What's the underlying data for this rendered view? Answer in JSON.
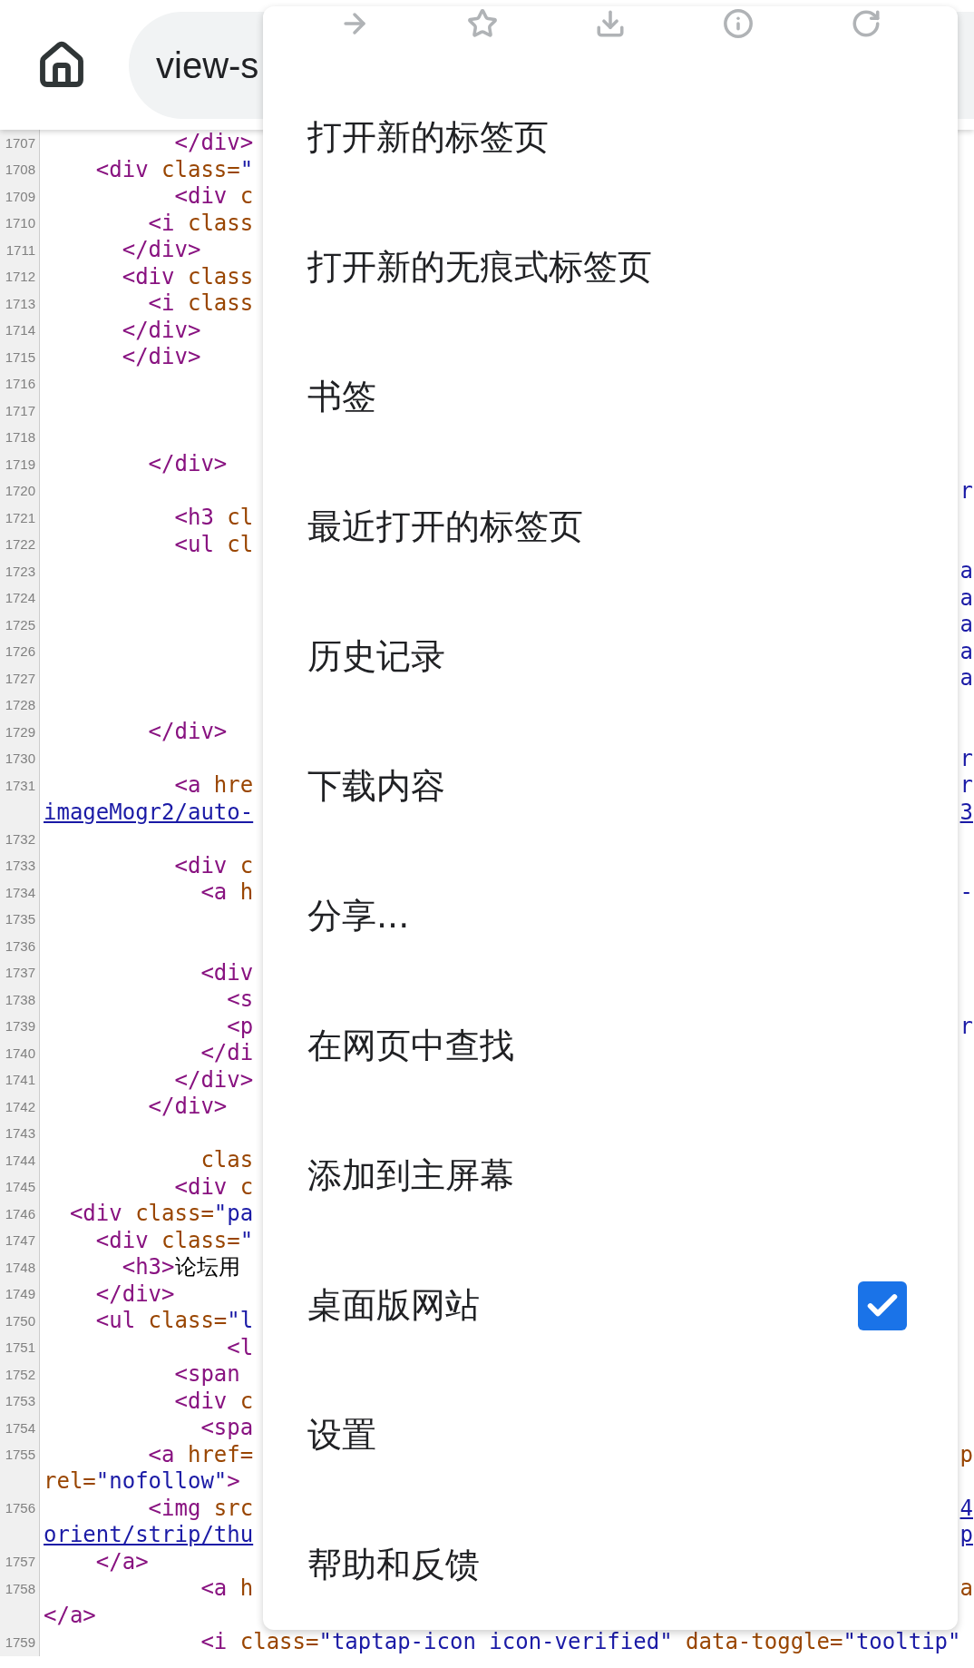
{
  "toolbar": {
    "url": "view-s"
  },
  "source": {
    "rows": [
      {
        "number": "1707",
        "segments": [
          {
            "kind": "tag",
            "text": "          </div>"
          }
        ]
      },
      {
        "number": "1708",
        "segments": [
          {
            "kind": "tag",
            "text": "    <div"
          },
          {
            "kind": "attr",
            "text": " class="
          },
          {
            "kind": "value",
            "text": "\""
          }
        ]
      },
      {
        "number": "1709",
        "segments": [
          {
            "kind": "tag",
            "text": "          <div"
          },
          {
            "kind": "attr",
            "text": " c"
          }
        ]
      },
      {
        "number": "1710",
        "segments": [
          {
            "kind": "tag",
            "text": "        <i"
          },
          {
            "kind": "attr",
            "text": " class"
          }
        ]
      },
      {
        "number": "1711",
        "segments": [
          {
            "kind": "tag",
            "text": "      </div>"
          }
        ]
      },
      {
        "number": "1712",
        "segments": [
          {
            "kind": "tag",
            "text": "      <div"
          },
          {
            "kind": "attr",
            "text": " class"
          }
        ]
      },
      {
        "number": "1713",
        "segments": [
          {
            "kind": "tag",
            "text": "        <i"
          },
          {
            "kind": "attr",
            "text": " class"
          }
        ]
      },
      {
        "number": "1714",
        "segments": [
          {
            "kind": "tag",
            "text": "      </div>"
          }
        ]
      },
      {
        "number": "1715",
        "segments": [
          {
            "kind": "tag",
            "text": "      </div>"
          }
        ]
      },
      {
        "number": "1716",
        "segments": []
      },
      {
        "number": "1717",
        "segments": []
      },
      {
        "number": "1718",
        "segments": []
      },
      {
        "number": "1719",
        "segments": [
          {
            "kind": "tag",
            "text": "        </div>"
          }
        ]
      },
      {
        "number": "1720",
        "segments": [],
        "edge": {
          "kind": "value",
          "text": "r"
        }
      },
      {
        "number": "1721",
        "segments": [
          {
            "kind": "tag",
            "text": "          <h3"
          },
          {
            "kind": "attr",
            "text": " cl"
          }
        ]
      },
      {
        "number": "1722",
        "segments": [
          {
            "kind": "tag",
            "text": "          <ul"
          },
          {
            "kind": "attr",
            "text": " cl"
          }
        ]
      },
      {
        "number": "1723",
        "segments": [],
        "edge": {
          "kind": "value",
          "text": "a"
        }
      },
      {
        "number": "1724",
        "segments": [],
        "edge": {
          "kind": "value",
          "text": "a"
        }
      },
      {
        "number": "1725",
        "segments": [],
        "edge": {
          "kind": "value",
          "text": "a"
        }
      },
      {
        "number": "1726",
        "segments": [],
        "edge": {
          "kind": "value",
          "text": "a"
        }
      },
      {
        "number": "1727",
        "segments": [],
        "edge": {
          "kind": "value",
          "text": "a"
        }
      },
      {
        "number": "1728",
        "segments": []
      },
      {
        "number": "1729",
        "segments": [
          {
            "kind": "tag",
            "text": "        </div>"
          }
        ]
      },
      {
        "number": "1730",
        "segments": [],
        "edge": {
          "kind": "value",
          "text": "r"
        }
      },
      {
        "number": "1731",
        "segments": [
          {
            "kind": "tag",
            "text": "          <a"
          },
          {
            "kind": "attr",
            "text": " hre"
          }
        ],
        "edge": {
          "kind": "value",
          "text": "r"
        }
      },
      {
        "segments": [
          {
            "kind": "link",
            "text": "imageMogr2/auto-"
          }
        ],
        "edge": {
          "kind": "link",
          "text": "3"
        }
      },
      {
        "number": "1732",
        "segments": []
      },
      {
        "number": "1733",
        "segments": [
          {
            "kind": "tag",
            "text": "          <div"
          },
          {
            "kind": "attr",
            "text": " c"
          }
        ]
      },
      {
        "number": "1734",
        "segments": [
          {
            "kind": "tag",
            "text": "            <a"
          },
          {
            "kind": "attr",
            "text": " h"
          }
        ],
        "edge": {
          "kind": "value",
          "text": "-"
        }
      },
      {
        "number": "1735",
        "segments": []
      },
      {
        "number": "1736",
        "segments": []
      },
      {
        "number": "1737",
        "segments": [
          {
            "kind": "tag",
            "text": "            <div"
          }
        ]
      },
      {
        "number": "1738",
        "segments": [
          {
            "kind": "tag",
            "text": "              <s"
          }
        ]
      },
      {
        "number": "1739",
        "segments": [
          {
            "kind": "tag",
            "text": "              <p"
          }
        ],
        "edge": {
          "kind": "value",
          "text": "r"
        }
      },
      {
        "number": "1740",
        "segments": [
          {
            "kind": "tag",
            "text": "            </di"
          }
        ]
      },
      {
        "number": "1741",
        "segments": [
          {
            "kind": "tag",
            "text": "          </div>"
          }
        ]
      },
      {
        "number": "1742",
        "segments": [
          {
            "kind": "tag",
            "text": "        </div>"
          }
        ]
      },
      {
        "number": "1743",
        "segments": []
      },
      {
        "number": "1744",
        "segments": [
          {
            "kind": "attr",
            "text": "            clas"
          }
        ]
      },
      {
        "number": "1745",
        "segments": [
          {
            "kind": "tag",
            "text": "          <div"
          },
          {
            "kind": "attr",
            "text": " c"
          }
        ]
      },
      {
        "number": "1746",
        "segments": [
          {
            "kind": "tag",
            "text": "  <div"
          },
          {
            "kind": "attr",
            "text": " class="
          },
          {
            "kind": "value",
            "text": "\"pa"
          }
        ]
      },
      {
        "number": "1747",
        "segments": [
          {
            "kind": "tag",
            "text": "    <div"
          },
          {
            "kind": "attr",
            "text": " class="
          },
          {
            "kind": "value",
            "text": "\""
          }
        ]
      },
      {
        "number": "1748",
        "segments": [
          {
            "kind": "tag",
            "text": "      <h3>"
          },
          {
            "kind": "text",
            "text": "论坛用"
          }
        ]
      },
      {
        "number": "1749",
        "segments": [
          {
            "kind": "tag",
            "text": "    </div>"
          }
        ]
      },
      {
        "number": "1750",
        "segments": [
          {
            "kind": "tag",
            "text": "    <ul"
          },
          {
            "kind": "attr",
            "text": " class="
          },
          {
            "kind": "value",
            "text": "\"l"
          }
        ]
      },
      {
        "number": "1751",
        "segments": [
          {
            "kind": "tag",
            "text": "              <l"
          }
        ]
      },
      {
        "number": "1752",
        "segments": [
          {
            "kind": "tag",
            "text": "          <span"
          }
        ]
      },
      {
        "number": "1753",
        "segments": [
          {
            "kind": "tag",
            "text": "          <div"
          },
          {
            "kind": "attr",
            "text": " c"
          }
        ]
      },
      {
        "number": "1754",
        "segments": [
          {
            "kind": "tag",
            "text": "            <spa"
          }
        ]
      },
      {
        "number": "1755",
        "segments": [
          {
            "kind": "tag",
            "text": "        <a"
          },
          {
            "kind": "attr",
            "text": " href="
          }
        ],
        "edge": {
          "kind": "attr",
          "text": "p"
        }
      },
      {
        "segments": [
          {
            "kind": "attr",
            "text": "rel="
          },
          {
            "kind": "value",
            "text": "\"nofollow\""
          },
          {
            "kind": "tag",
            "text": ">"
          }
        ]
      },
      {
        "number": "1756",
        "segments": [
          {
            "kind": "tag",
            "text": "        <img"
          },
          {
            "kind": "attr",
            "text": " src"
          }
        ],
        "edge": {
          "kind": "link",
          "text": "4"
        }
      },
      {
        "segments": [
          {
            "kind": "link",
            "text": "orient/strip/thu"
          }
        ],
        "edge": {
          "kind": "link",
          "text": "p"
        }
      },
      {
        "number": "1757",
        "segments": [
          {
            "kind": "tag",
            "text": "    </a>"
          }
        ]
      },
      {
        "number": "1758",
        "segments": [
          {
            "kind": "tag",
            "text": "            <a"
          },
          {
            "kind": "attr",
            "text": " h"
          }
        ],
        "edge": {
          "kind": "attr",
          "text": "a"
        }
      },
      {
        "segments": [
          {
            "kind": "tag",
            "text": "</a>"
          }
        ]
      },
      {
        "number": "1759",
        "segments": [
          {
            "kind": "tag",
            "text": "            <i"
          },
          {
            "kind": "attr",
            "text": " class="
          },
          {
            "kind": "value",
            "text": "\"taptap-icon icon-verified\""
          },
          {
            "kind": "attr",
            "text": " data-toggle="
          },
          {
            "kind": "value",
            "text": "\"tooltip\""
          }
        ]
      }
    ]
  },
  "menu": {
    "items": [
      {
        "label": "打开新的标签页",
        "kind": "plain"
      },
      {
        "label": "打开新的无痕式标签页",
        "kind": "plain"
      },
      {
        "label": "书签",
        "kind": "plain"
      },
      {
        "label": "最近打开的标签页",
        "kind": "plain"
      },
      {
        "label": "历史记录",
        "kind": "plain"
      },
      {
        "label": "下载内容",
        "kind": "plain"
      },
      {
        "label": "分享...",
        "kind": "plain"
      },
      {
        "label": "在网页中查找",
        "kind": "plain"
      },
      {
        "label": "添加到主屏幕",
        "kind": "plain"
      },
      {
        "label": "桌面版网站",
        "kind": "checkbox",
        "checked": true
      },
      {
        "label": "设置",
        "kind": "plain"
      },
      {
        "label": "帮助和反馈",
        "kind": "plain"
      }
    ]
  }
}
